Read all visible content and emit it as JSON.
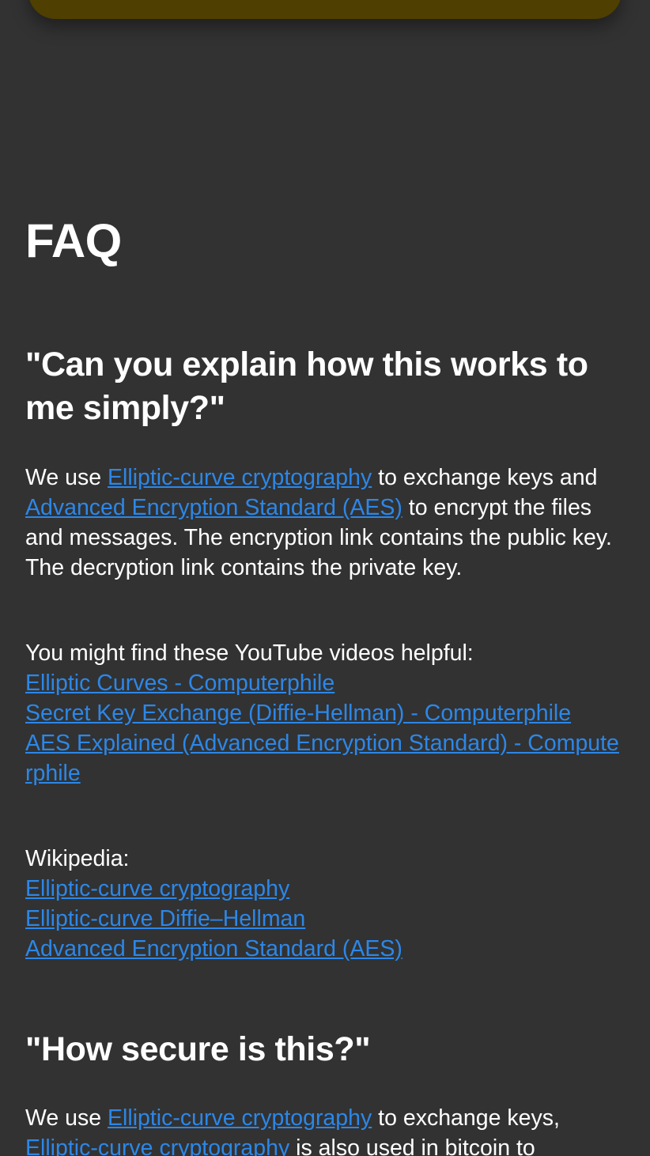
{
  "faq": {
    "title": "FAQ",
    "q1": {
      "question": "\"Can you explain how this works to me simply?\"",
      "p1": {
        "t1": "We use ",
        "link1": "Elliptic-curve cryptography",
        "t2": " to exchange keys and ",
        "link2": "Advanced Encryption Standard (AES)",
        "t3": " to encrypt the files and messages. The encryption link contains the public key. The decryption link contains the private key."
      },
      "youtube": {
        "intro": "You might find these YouTube videos helpful:",
        "links": [
          "Elliptic Curves - Computerphile",
          "Secret Key Exchange (Diffie-Hellman) - Computerphile",
          "AES Explained (Advanced Encryption Standard) - Computerphile"
        ]
      },
      "wikipedia": {
        "intro": "Wikipedia:",
        "links": [
          "Elliptic-curve cryptography",
          "Elliptic-curve Diffie–Hellman",
          "Advanced Encryption Standard (AES)"
        ]
      }
    },
    "q2": {
      "question": "\"How secure is this?\"",
      "p1": {
        "t1": "We use ",
        "link1": "Elliptic-curve cryptography",
        "t2": " to exchange keys, ",
        "link2": "Elliptic-curve cryptography",
        "t3": " is also used in bitcoin to"
      }
    }
  },
  "colors": {
    "background": "#323232",
    "link": "#2c87e8",
    "top_card": "#4f3f00",
    "text": "#ffffff"
  }
}
